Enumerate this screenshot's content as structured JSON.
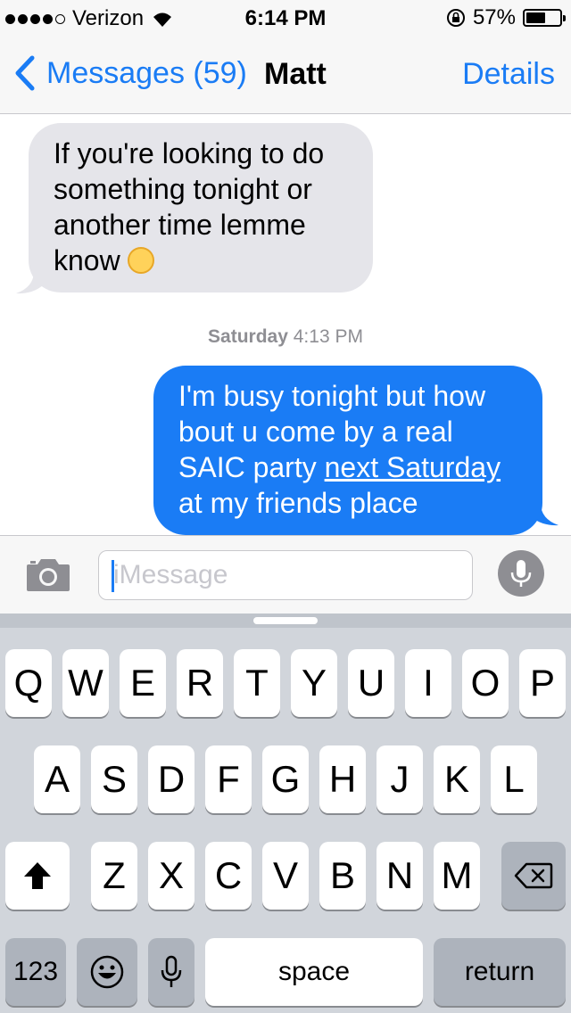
{
  "status_bar": {
    "carrier": "Verizon",
    "time": "6:14 PM",
    "battery": "57%",
    "battery_level": 0.57,
    "icons": [
      "wifi-icon",
      "rotation-lock-icon",
      "battery-icon"
    ]
  },
  "nav": {
    "back_label": "Messages (59)",
    "title": "Matt",
    "details_label": "Details"
  },
  "messages": {
    "incoming": {
      "text": "If you're looking to do something tonight or another time lemme know",
      "emoji": "upside-down-face-emoji"
    },
    "timestamp_day": "Saturday",
    "timestamp_time": "4:13 PM",
    "outgoing": {
      "text_before": "I'm busy tonight but how bout u come by a real SAIC party",
      "link": "next Saturday",
      "text_after": "at my friends place"
    }
  },
  "input": {
    "placeholder": "iMessage"
  },
  "keyboard": {
    "row1": [
      "Q",
      "W",
      "E",
      "R",
      "T",
      "Y",
      "U",
      "I",
      "O",
      "P"
    ],
    "row2": [
      "A",
      "S",
      "D",
      "F",
      "G",
      "H",
      "J",
      "K",
      "L"
    ],
    "row3": [
      "Z",
      "X",
      "C",
      "V",
      "B",
      "N",
      "M"
    ],
    "numbers_label": "123",
    "space_label": "space",
    "return_label": "return"
  },
  "colors": {
    "accent": "#1a7cf5",
    "incoming_bubble": "#e5e5ea",
    "keyboard_bg": "#d1d5db"
  }
}
